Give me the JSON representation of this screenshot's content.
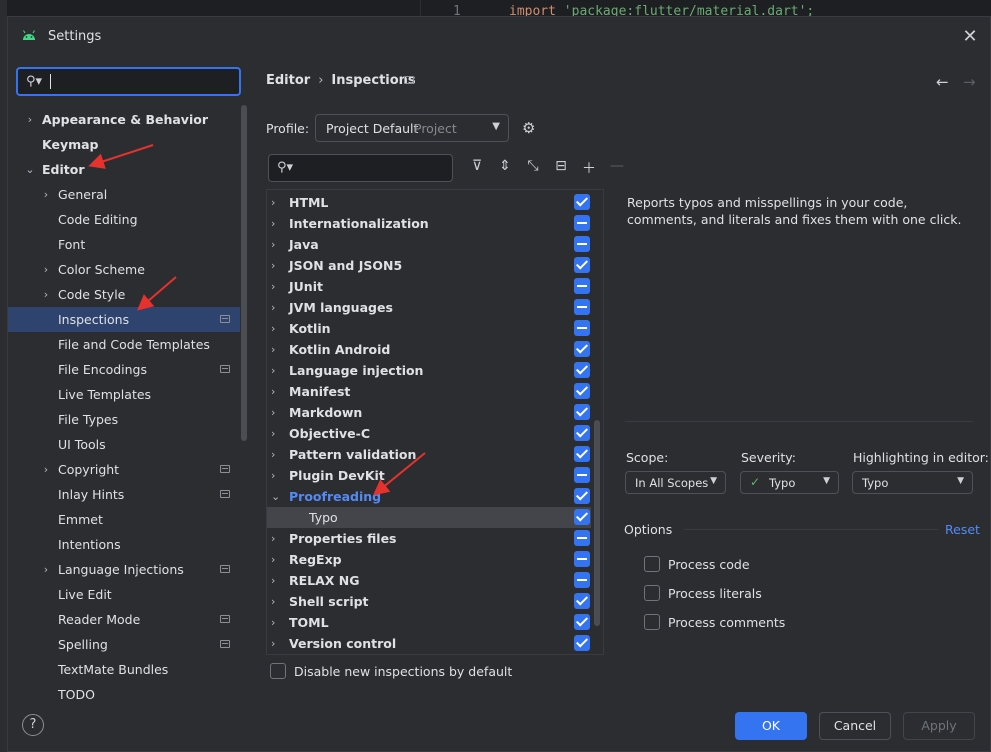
{
  "background_editor": {
    "line_number": "1",
    "code_keyword": "import ",
    "code_string": "'package:flutter/material.dart';"
  },
  "dialog": {
    "title": "Settings",
    "close_label": "✕"
  },
  "left": {
    "search_value": "",
    "tree": [
      {
        "label": "Appearance & Behavior",
        "level": 0,
        "expandable": true,
        "expanded": false,
        "bold": true
      },
      {
        "label": "Keymap",
        "level": 0,
        "expandable": false,
        "bold": true
      },
      {
        "label": "Editor",
        "level": 0,
        "expandable": true,
        "expanded": true,
        "bold": true
      },
      {
        "label": "General",
        "level": 1,
        "expandable": true
      },
      {
        "label": "Code Editing",
        "level": 1
      },
      {
        "label": "Font",
        "level": 1
      },
      {
        "label": "Color Scheme",
        "level": 1,
        "expandable": true
      },
      {
        "label": "Code Style",
        "level": 1,
        "expandable": true
      },
      {
        "label": "Inspections",
        "level": 1,
        "selected": true,
        "project": true
      },
      {
        "label": "File and Code Templates",
        "level": 1
      },
      {
        "label": "File Encodings",
        "level": 1,
        "project": true
      },
      {
        "label": "Live Templates",
        "level": 1
      },
      {
        "label": "File Types",
        "level": 1
      },
      {
        "label": "UI Tools",
        "level": 1
      },
      {
        "label": "Copyright",
        "level": 1,
        "expandable": true,
        "project": true
      },
      {
        "label": "Inlay Hints",
        "level": 1,
        "project": true
      },
      {
        "label": "Emmet",
        "level": 1
      },
      {
        "label": "Intentions",
        "level": 1
      },
      {
        "label": "Language Injections",
        "level": 1,
        "expandable": true,
        "project": true
      },
      {
        "label": "Live Edit",
        "level": 1
      },
      {
        "label": "Reader Mode",
        "level": 1,
        "project": true
      },
      {
        "label": "Spelling",
        "level": 1,
        "project": true
      },
      {
        "label": "TextMate Bundles",
        "level": 1
      },
      {
        "label": "TODO",
        "level": 1
      }
    ]
  },
  "breadcrumb": {
    "first": "Editor",
    "separator": "›",
    "second": "Inspections"
  },
  "profile": {
    "label": "Profile:",
    "value": "Project Default",
    "scope": "Project"
  },
  "inspections": [
    {
      "label": "HTML",
      "state": "check"
    },
    {
      "label": "Internationalization",
      "state": "dash"
    },
    {
      "label": "Java",
      "state": "dash"
    },
    {
      "label": "JSON and JSON5",
      "state": "check"
    },
    {
      "label": "JUnit",
      "state": "dash"
    },
    {
      "label": "JVM languages",
      "state": "dash"
    },
    {
      "label": "Kotlin",
      "state": "dash"
    },
    {
      "label": "Kotlin Android",
      "state": "check"
    },
    {
      "label": "Language injection",
      "state": "check"
    },
    {
      "label": "Manifest",
      "state": "check"
    },
    {
      "label": "Markdown",
      "state": "check"
    },
    {
      "label": "Objective-C",
      "state": "check"
    },
    {
      "label": "Pattern validation",
      "state": "check"
    },
    {
      "label": "Plugin DevKit",
      "state": "dash"
    },
    {
      "label": "Proofreading",
      "state": "check",
      "expanded": true,
      "active": true
    },
    {
      "label": "Typo",
      "state": "check",
      "child": true,
      "selected": true
    },
    {
      "label": "Properties files",
      "state": "dash"
    },
    {
      "label": "RegExp",
      "state": "dash"
    },
    {
      "label": "RELAX NG",
      "state": "dash"
    },
    {
      "label": "Shell script",
      "state": "check"
    },
    {
      "label": "TOML",
      "state": "check"
    },
    {
      "label": "Version control",
      "state": "check"
    }
  ],
  "disable_new_label": "Disable new inspections by default",
  "description": "Reports typos and misspellings in your code, comments, and literals and fixes them with one click.",
  "scope": {
    "label": "Scope:",
    "value": "In All Scopes"
  },
  "severity": {
    "label": "Severity:",
    "value": "Typo"
  },
  "highlighting": {
    "label": "Highlighting in editor:",
    "value": "Typo"
  },
  "options": {
    "label": "Options",
    "reset": "Reset",
    "items": [
      "Process code",
      "Process literals",
      "Process comments"
    ]
  },
  "buttons": {
    "ok": "OK",
    "cancel": "Cancel",
    "apply": "Apply"
  },
  "colors": {
    "accent": "#3574f0",
    "selection": "#2e436e",
    "arrow": "#e5322d"
  }
}
